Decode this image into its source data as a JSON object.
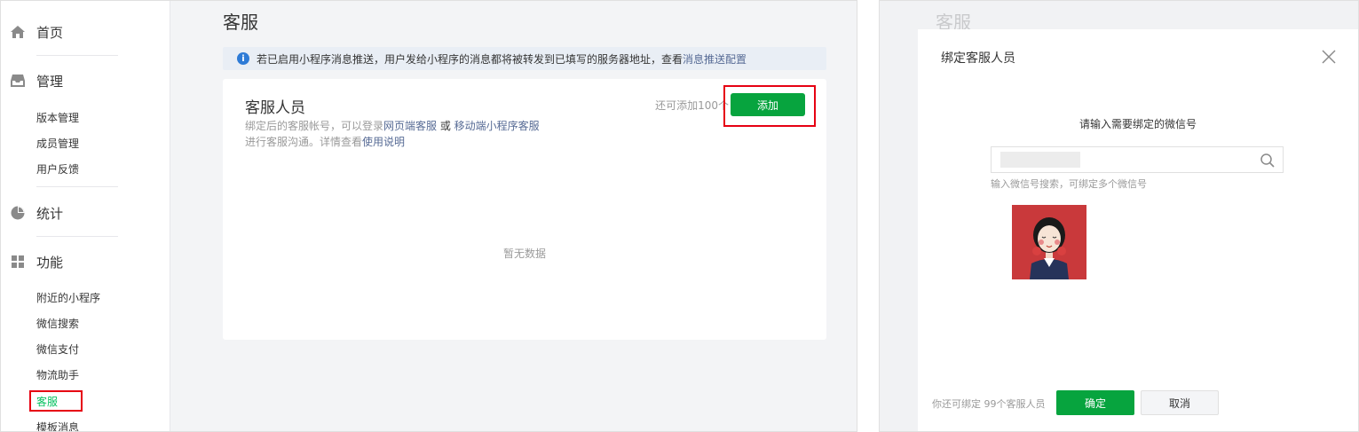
{
  "left": {
    "sidebar": {
      "sections": [
        {
          "label": "首页",
          "icon": "home-icon"
        },
        {
          "label": "管理",
          "icon": "inbox-icon"
        },
        {
          "label": "统计",
          "icon": "pie-chart-icon"
        },
        {
          "label": "功能",
          "icon": "grid-icon"
        }
      ],
      "manage_items": [
        "版本管理",
        "成员管理",
        "用户反馈"
      ],
      "feature_items": [
        "附近的小程序",
        "微信搜索",
        "微信支付",
        "物流助手",
        "客服",
        "模板消息"
      ],
      "active_item": "客服"
    },
    "page_title": "客服",
    "notice": {
      "text": "若已启用小程序消息推送，用户发给小程序的消息都将被转发到已填写的服务器地址，查看 ",
      "link": "消息推送配置"
    },
    "card": {
      "title": "客服人员",
      "desc_line1_prefix": "绑定后的客服帐号，可以登录",
      "desc_link1": "网页端客服",
      "desc_or": " 或 ",
      "desc_link2": "移动端小程序客服",
      "desc_line2_prefix": "进行客服沟通。详情查看",
      "desc_link3": "使用说明",
      "quota": "还可添加100个",
      "add_button": "添加",
      "empty_text": "暂无数据"
    }
  },
  "right": {
    "ghost_title": "客服",
    "dialog": {
      "title": "绑定客服人员",
      "prompt": "请输入需要绑定的微信号",
      "search_value": "",
      "search_hint": "输入微信号搜索，可绑定多个微信号",
      "footer_note": "你还可绑定 99个客服人员",
      "confirm_button": "确定",
      "cancel_button": "取消"
    }
  },
  "colors": {
    "accent_green": "#07a43e",
    "active_green": "#07c160",
    "link_blue": "#576b95",
    "highlight_red": "#e60012",
    "info_blue": "#2e7bd6",
    "avatar_background": "#c9393b"
  }
}
